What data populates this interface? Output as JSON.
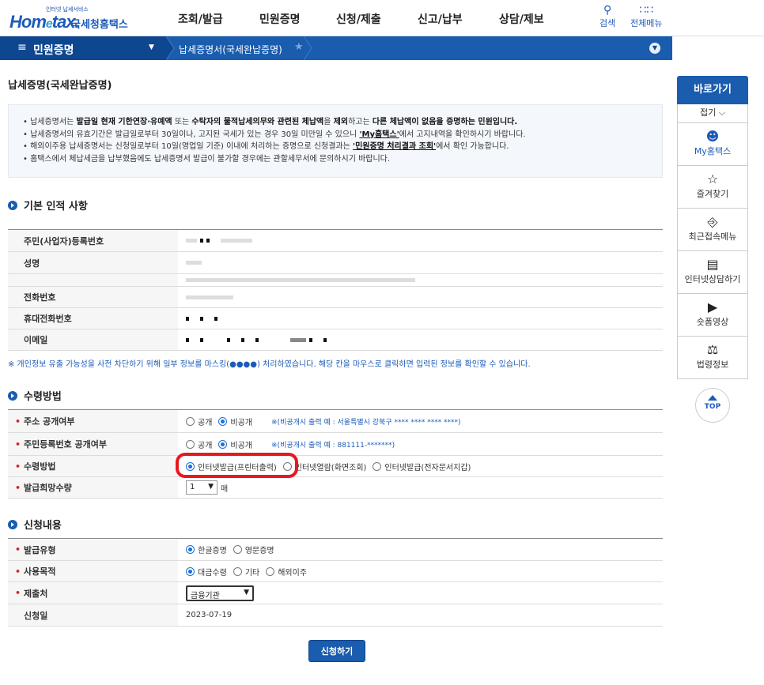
{
  "header": {
    "logo_small": "인터넷 납세서비스",
    "logo_brand_main": "Hom",
    "logo_brand_e": "e",
    "logo_brand_tail": "tax.",
    "logo_ko": "국세청홈택스",
    "nav": [
      "조회/발급",
      "민원증명",
      "신청/제출",
      "신고/납부",
      "상담/제보"
    ],
    "search_label": "검색",
    "all_menu_label": "전체메뉴"
  },
  "menubar": {
    "menu": "민원증명",
    "breadcrumb": "납세증명서(국세완납증명)"
  },
  "page": {
    "title": "납세증명(국세완납증명)"
  },
  "notice": {
    "l1a": "• 납세증명서는 ",
    "l1b": "발급일 현재 기한연장·유예액",
    "l1c": " 또는 ",
    "l1d": "수탁자의 물적납세의무와 관련된 체납액",
    "l1e": "을 ",
    "l1f": "제외",
    "l1g": "하고는 ",
    "l1h": "다른 체납액이 없음을 증명하는 민원입니다.",
    "l2a": "• 납세증명서의 유효기간은 발급일로부터 30일이나, 고지된 국세가 있는 경우 30일 미만일 수 있으니 ",
    "l2b": "'My홈택스'",
    "l2c": "에서 고지내역을 확인하시기 바랍니다.",
    "l3a": "• 해외이주용 납세증명서는 신청일로부터 10일(영업일 기준) 이내에 처리하는 증명으로 신청결과는 ",
    "l3b": "'민원증명 처리결과 조회'",
    "l3c": "에서 확인 가능합니다.",
    "l4": "• 홈택스에서 체납세금을 납부했음에도 납세증명서 발급이 불가할 경우에는 관할세무서에 문의하시기 바랍니다."
  },
  "basic": {
    "heading": "기본 인적 사항",
    "rows": [
      "주민(사업자)등록번호",
      "성명",
      "",
      "전화번호",
      "휴대전화번호",
      "이메일"
    ]
  },
  "privacy_note": "※ 개인정보 유출 가능성을 사전 차단하기 위해 일부 정보를 마스킹(●●●●) 처리하였습니다. 해당 칸을 마우스로 클릭하면 입력된 정보를 확인할 수 있습니다.",
  "receive": {
    "heading": "수령방법",
    "address_label": "주소 공개여부",
    "address_opts": [
      "공개",
      "비공개"
    ],
    "address_hint": "※(비공개시 출력 예 : 서울특별시 강북구 **** **** **** ****)",
    "rrn_label": "주민등록번호 공개여부",
    "rrn_opts": [
      "공개",
      "비공개"
    ],
    "rrn_hint": "※(비공개시 출력 예 : 881111-*******)",
    "method_label": "수령방법",
    "method_opts": [
      "인터넷발급(프린터출력)",
      "인터넷열람(화면조회)",
      "인터넷발급(전자문서지갑)"
    ],
    "qty_label": "발급희망수량",
    "qty_value": "1",
    "qty_unit": "매"
  },
  "apply": {
    "heading": "신청내용",
    "type_label": "발급유형",
    "type_opts": [
      "한글증명",
      "영문증명"
    ],
    "purpose_label": "사용목적",
    "purpose_opts": [
      "대금수령",
      "기타",
      "해외이주"
    ],
    "submit_to_label": "제출처",
    "submit_to_value": "금융기관",
    "date_label": "신청일",
    "date_value": "2023-07-19"
  },
  "submit_label": "신청하기",
  "quick": {
    "title": "바로가기",
    "fold": "접기 ⌵",
    "items": [
      "My홈택스",
      "즐겨찾기",
      "최근접속메뉴",
      "인터넷상담하기",
      "숏폼영상",
      "법령정보"
    ],
    "top": "TOP"
  },
  "colors": {
    "brand_blue": "#1a5cae",
    "required_red": "#d0262e",
    "highlight_red": "#e8181f"
  }
}
